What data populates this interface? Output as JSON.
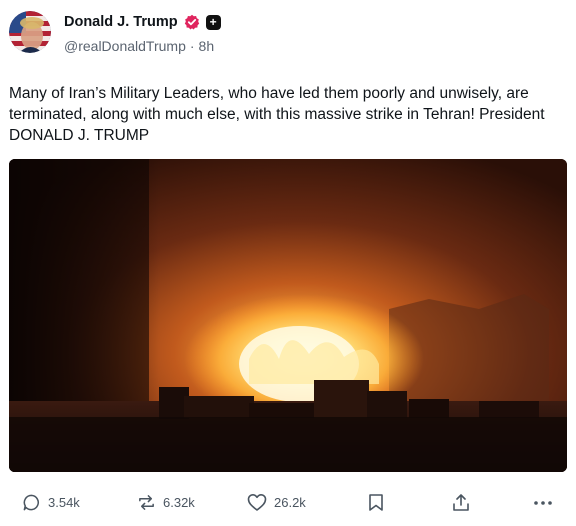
{
  "author": {
    "display_name": "Donald J. Trump",
    "handle": "@realDonaldTrump",
    "separator": "·",
    "time_ago": "8h",
    "verified_badge_color": "#e0245e"
  },
  "post": {
    "text": "Many of Iran’s Military Leaders, who have led them poorly and unwisely, are terminated, along with much else, with this massive strike in Tehran! President DONALD J. TRUMP"
  },
  "media": {
    "kind": "image",
    "subject": "night explosion over city skyline"
  },
  "actions": {
    "reply_count": "3.54k",
    "repost_count": "6.32k",
    "like_count": "26.2k"
  },
  "icons": {
    "reply": "reply-icon",
    "repost": "repost-icon",
    "like": "heart-icon",
    "bookmark": "bookmark-icon",
    "share": "share-icon",
    "more": "more-icon"
  }
}
